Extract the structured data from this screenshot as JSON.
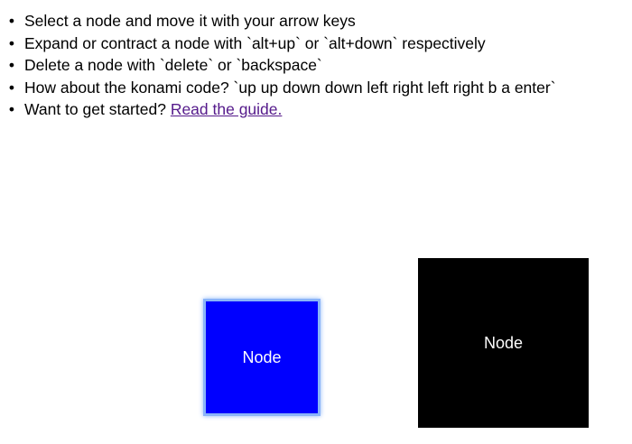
{
  "instructions": {
    "items": [
      {
        "text": "Select a node and move it with your arrow keys"
      },
      {
        "text": "Expand or contract a node with `alt+up` or `alt+down` respectively"
      },
      {
        "text": "Delete a node with `delete` or `backspace`"
      },
      {
        "text": "How about the konami code? `up up down down left right left right b a enter`"
      },
      {
        "text": "Want to get started? ",
        "link": "Read the guide."
      }
    ],
    "bullet": "•"
  },
  "nodes": [
    {
      "label": "Node",
      "color": "#0000ff",
      "selected": true
    },
    {
      "label": "Node",
      "color": "#000000",
      "selected": false
    }
  ],
  "colors": {
    "link": "#551a8b",
    "selection_glow": "#8ab4f8"
  }
}
